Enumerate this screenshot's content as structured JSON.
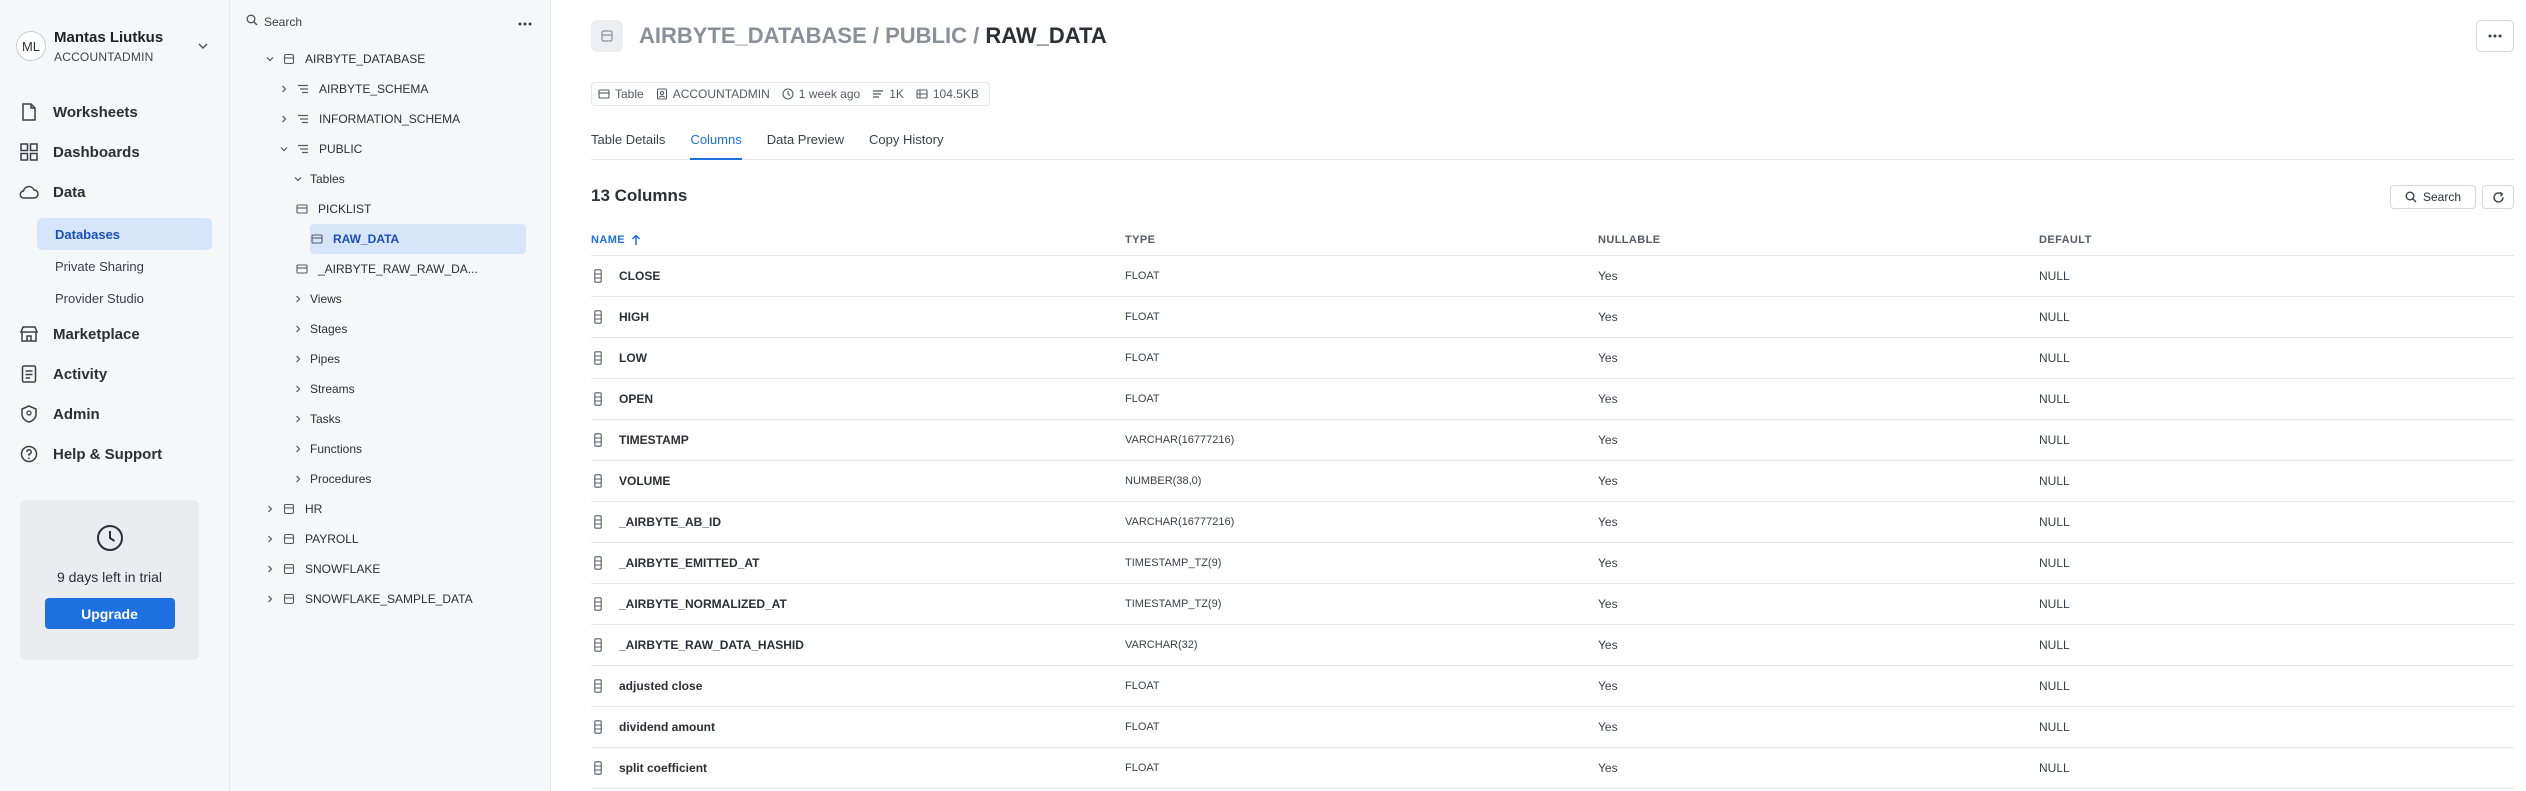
{
  "user": {
    "initials": "ML",
    "name": "Mantas Liutkus",
    "role": "ACCOUNTADMIN"
  },
  "nav": {
    "worksheets": "Worksheets",
    "dashboards": "Dashboards",
    "data": "Data",
    "data_sub": [
      "Databases",
      "Private Sharing",
      "Provider Studio"
    ],
    "marketplace": "Marketplace",
    "activity": "Activity",
    "admin": "Admin",
    "help": "Help & Support"
  },
  "trial": {
    "text": "9 days left in trial",
    "button": "Upgrade"
  },
  "explorer": {
    "search_label": "Search",
    "tree": [
      {
        "label": "AIRBYTE_DATABASE",
        "level": 0,
        "chevron": "down",
        "icon": "database-icon"
      },
      {
        "label": "AIRBYTE_SCHEMA",
        "level": 1,
        "chevron": "right",
        "icon": "schema-icon"
      },
      {
        "label": "INFORMATION_SCHEMA",
        "level": 1,
        "chevron": "right",
        "icon": "schema-icon"
      },
      {
        "label": "PUBLIC",
        "level": 1,
        "chevron": "down",
        "icon": "schema-icon"
      },
      {
        "label": "Tables",
        "level": 2,
        "chevron": "down",
        "icon": ""
      },
      {
        "label": "PICKLIST",
        "level": 3,
        "chevron": "",
        "icon": "table-icon"
      },
      {
        "label": "RAW_DATA",
        "level": 3,
        "chevron": "",
        "icon": "table-icon",
        "selected": true
      },
      {
        "label": "_AIRBYTE_RAW_RAW_DA...",
        "level": 3,
        "chevron": "",
        "icon": "table-icon"
      },
      {
        "label": "Views",
        "level": 2,
        "chevron": "right",
        "icon": ""
      },
      {
        "label": "Stages",
        "level": 2,
        "chevron": "right",
        "icon": ""
      },
      {
        "label": "Pipes",
        "level": 2,
        "chevron": "right",
        "icon": ""
      },
      {
        "label": "Streams",
        "level": 2,
        "chevron": "right",
        "icon": ""
      },
      {
        "label": "Tasks",
        "level": 2,
        "chevron": "right",
        "icon": ""
      },
      {
        "label": "Functions",
        "level": 2,
        "chevron": "right",
        "icon": ""
      },
      {
        "label": "Procedures",
        "level": 2,
        "chevron": "right",
        "icon": ""
      },
      {
        "label": "HR",
        "level": 0,
        "chevron": "right",
        "icon": "database-icon"
      },
      {
        "label": "PAYROLL",
        "level": 0,
        "chevron": "right",
        "icon": "database-icon"
      },
      {
        "label": "SNOWFLAKE",
        "level": 0,
        "chevron": "right",
        "icon": "database-icon"
      },
      {
        "label": "SNOWFLAKE_SAMPLE_DATA",
        "level": 0,
        "chevron": "right",
        "icon": "database-icon"
      }
    ]
  },
  "header": {
    "crumb_db": "AIRBYTE_DATABASE",
    "sep1": " / ",
    "crumb_schema": "PUBLIC",
    "sep2": " / ",
    "crumb_table": "RAW_DATA"
  },
  "meta": {
    "kind": "Table",
    "owner": "ACCOUNTADMIN",
    "updated": "1 week ago",
    "rows": "1K",
    "size": "104.5KB"
  },
  "tabs": [
    "Table Details",
    "Columns",
    "Data Preview",
    "Copy History"
  ],
  "active_tab": 1,
  "columns_title": "13 Columns",
  "search_button": "Search",
  "table": {
    "headers": {
      "name": "NAME",
      "type": "TYPE",
      "nullable": "NULLABLE",
      "default": "DEFAULT"
    },
    "rows": [
      {
        "name": "CLOSE",
        "type": "FLOAT",
        "nullable": "Yes",
        "default": "NULL"
      },
      {
        "name": "HIGH",
        "type": "FLOAT",
        "nullable": "Yes",
        "default": "NULL"
      },
      {
        "name": "LOW",
        "type": "FLOAT",
        "nullable": "Yes",
        "default": "NULL"
      },
      {
        "name": "OPEN",
        "type": "FLOAT",
        "nullable": "Yes",
        "default": "NULL"
      },
      {
        "name": "TIMESTAMP",
        "type": "VARCHAR(16777216)",
        "nullable": "Yes",
        "default": "NULL"
      },
      {
        "name": "VOLUME",
        "type": "NUMBER(38,0)",
        "nullable": "Yes",
        "default": "NULL"
      },
      {
        "name": "_AIRBYTE_AB_ID",
        "type": "VARCHAR(16777216)",
        "nullable": "Yes",
        "default": "NULL"
      },
      {
        "name": "_AIRBYTE_EMITTED_AT",
        "type": "TIMESTAMP_TZ(9)",
        "nullable": "Yes",
        "default": "NULL"
      },
      {
        "name": "_AIRBYTE_NORMALIZED_AT",
        "type": "TIMESTAMP_TZ(9)",
        "nullable": "Yes",
        "default": "NULL"
      },
      {
        "name": "_AIRBYTE_RAW_DATA_HASHID",
        "type": "VARCHAR(32)",
        "nullable": "Yes",
        "default": "NULL"
      },
      {
        "name": "adjusted close",
        "type": "FLOAT",
        "nullable": "Yes",
        "default": "NULL"
      },
      {
        "name": "dividend amount",
        "type": "FLOAT",
        "nullable": "Yes",
        "default": "NULL"
      },
      {
        "name": "split coefficient",
        "type": "FLOAT",
        "nullable": "Yes",
        "default": "NULL"
      }
    ]
  },
  "colors": {
    "accent": "#1e6fe0",
    "selected_bg": "#d7e5fb",
    "sidebar_bg": "#f6f7f9"
  }
}
